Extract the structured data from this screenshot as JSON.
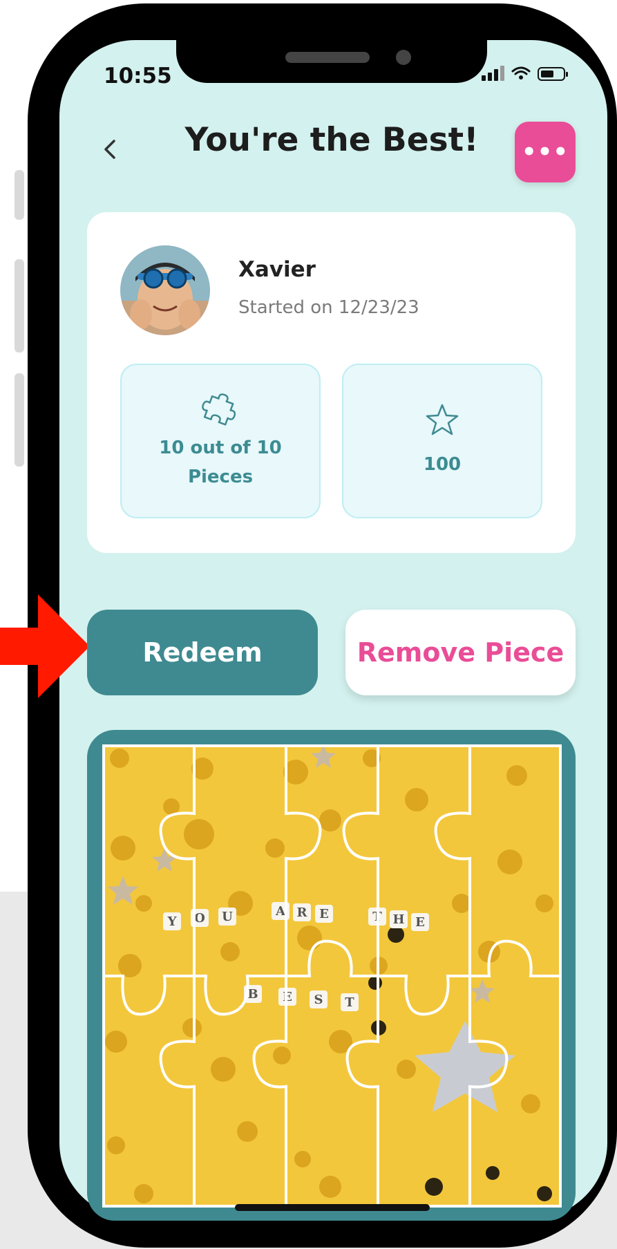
{
  "status_bar": {
    "time": "10:55"
  },
  "header": {
    "title": "You're the Best!",
    "menu_label": "•••"
  },
  "profile": {
    "name": "Xavier",
    "started": "Started on 12/23/23"
  },
  "stats": {
    "pieces_line1": "10 out of 10",
    "pieces_line2": "Pieces",
    "points": "100"
  },
  "actions": {
    "redeem": "Redeem",
    "remove": "Remove Piece"
  },
  "puzzle": {
    "words": [
      "Y",
      "O",
      "U",
      "A",
      "R",
      "E",
      "T",
      "H",
      "E",
      "B",
      "E",
      "S",
      "T"
    ]
  },
  "colors": {
    "accent_teal": "#3f8a91",
    "accent_pink": "#e94d97",
    "screen_bg": "#d3f1ee",
    "pointer_arrow": "#ff1a00"
  }
}
